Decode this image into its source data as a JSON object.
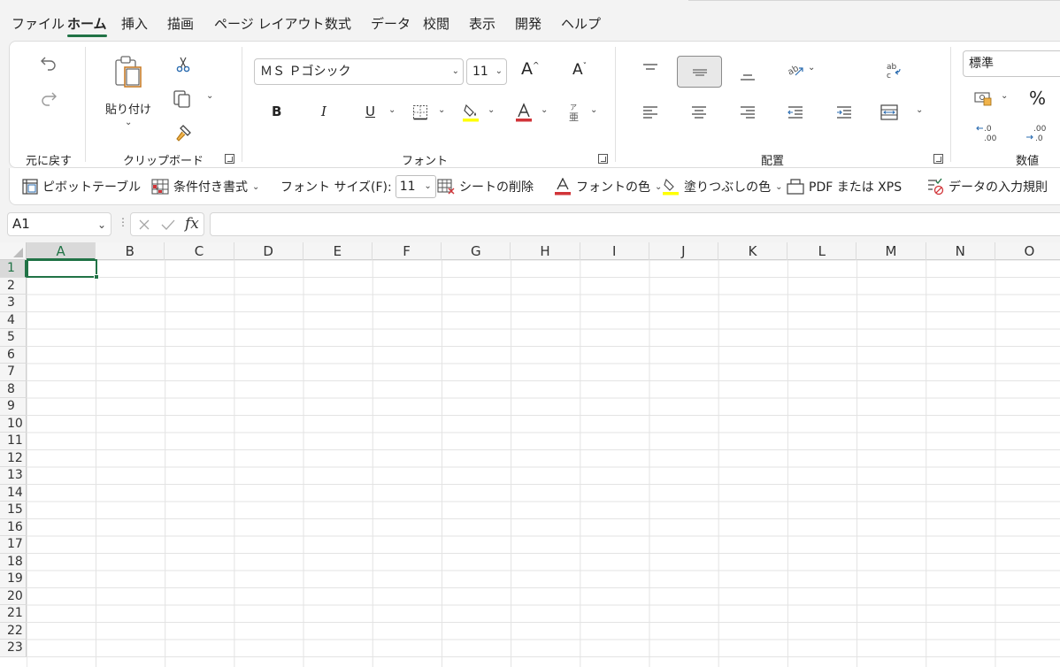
{
  "tabs": [
    "ファイル",
    "ホーム",
    "挿入",
    "描画",
    "ページ レイアウト",
    "数式",
    "データ",
    "校閲",
    "表示",
    "開発",
    "ヘルプ"
  ],
  "active_tab": "ホーム",
  "ribbon": {
    "undo_group_label": "元に戻す",
    "clipboard": {
      "label": "クリップボード",
      "paste_label": "貼り付け"
    },
    "font": {
      "label": "フォント",
      "font_name": "ＭＳ Ｐゴシック",
      "font_size": "11",
      "bold": "B",
      "italic": "I",
      "underline": "U",
      "grow": "A",
      "shrink": "A"
    },
    "alignment": {
      "label": "配置"
    },
    "number": {
      "label": "数値",
      "format": "標準",
      "percent": "%"
    }
  },
  "qat": {
    "pivot": "ピボットテーブル",
    "conditional": "条件付き書式",
    "font_size_label": "フォント サイズ(F):",
    "font_size_value": "11",
    "delete_sheet": "シートの削除",
    "font_color": "フォントの色",
    "fill_color": "塗りつぶしの色",
    "pdf_xps": "PDF または XPS",
    "data_validation": "データの入力規則"
  },
  "formula_bar": {
    "name_box": "A1",
    "fx": "fx",
    "formula": ""
  },
  "grid": {
    "columns": [
      "A",
      "B",
      "C",
      "D",
      "E",
      "F",
      "G",
      "H",
      "I",
      "J",
      "K",
      "L",
      "M",
      "N",
      "O"
    ],
    "rows": [
      "1",
      "2",
      "3",
      "4",
      "5",
      "6",
      "7",
      "8",
      "9",
      "10",
      "11",
      "12",
      "13",
      "14",
      "15",
      "16",
      "17",
      "18",
      "19",
      "20",
      "21",
      "22",
      "23"
    ],
    "active_cell": "A1"
  },
  "colors": {
    "accent": "#217346",
    "font_color": "#d13438",
    "fill_color": "#ffff00"
  }
}
